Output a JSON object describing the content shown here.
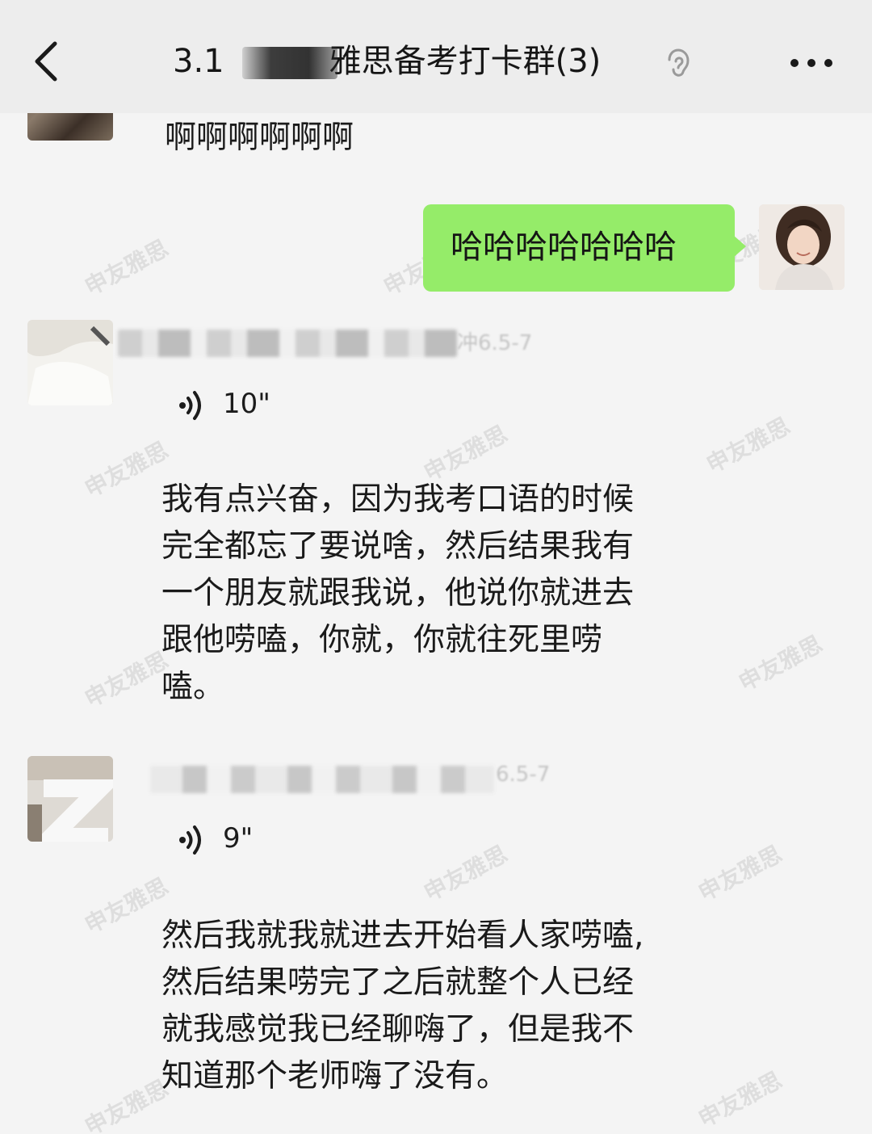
{
  "header": {
    "title": "3.1打卡雅思备考打卡群(3)",
    "title_visible_prefix": "3.1",
    "title_visible_suffix": "雅思备考打卡群(3)",
    "back_icon": "chevron-left-icon",
    "mute_icon": "ear-icon",
    "more_icon": "more-dots-icon"
  },
  "messages": [
    {
      "type": "text",
      "side": "left",
      "text": "啊啊啊啊啊啊"
    },
    {
      "type": "text",
      "side": "right",
      "text": "哈哈哈哈哈哈哈",
      "bubble_color": "#95ec69"
    },
    {
      "type": "voice",
      "side": "left",
      "sender_suffix": "冲6.5-7",
      "duration": "10\"",
      "transcript_lines": [
        "我有点兴奋，因为我考口语的时候",
        "完全都忘了要说啥，然后结果我有",
        "一个朋友就跟我说，他说你就进去",
        "跟他唠嗑，你就，你就往死里唠",
        "嗑。"
      ]
    },
    {
      "type": "voice",
      "side": "left",
      "sender_suffix": "6.5-7",
      "duration": "9\"",
      "transcript_lines": [
        "然后我就我就进去开始看人家唠嗑,",
        "然后结果唠完了之后就整个人已经",
        "就我感觉我已经聊嗨了，但是我不",
        "知道那个老师嗨了没有。"
      ]
    }
  ],
  "watermark": "申友雅思",
  "colors": {
    "topbar": "#ededed",
    "background": "#f4f4f4",
    "my_bubble": "#95ec69"
  }
}
